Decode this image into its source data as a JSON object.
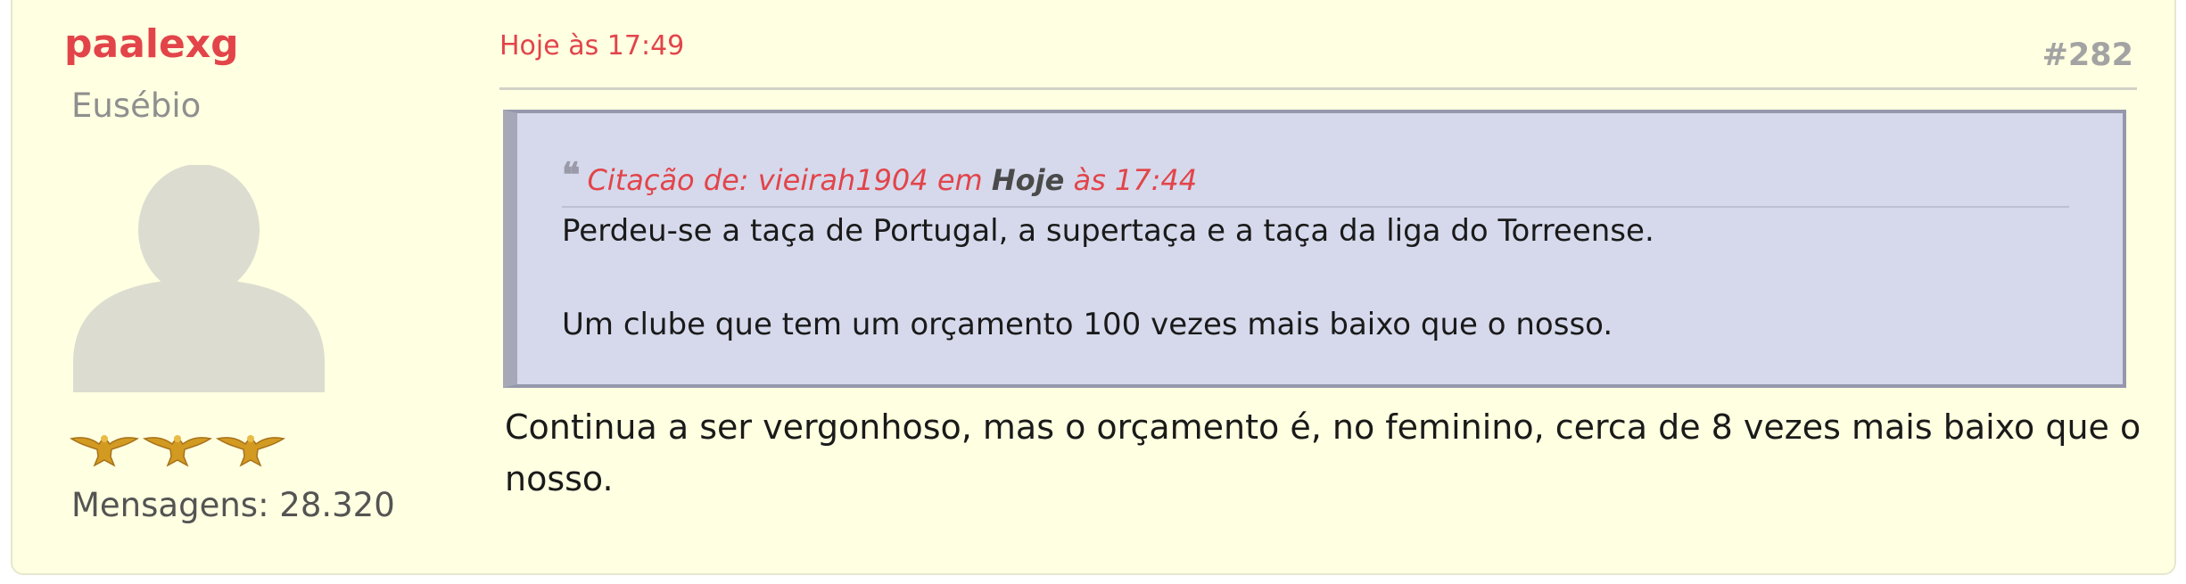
{
  "poster": {
    "username": "paalexg",
    "rank": "Eusébio",
    "avatar_icon": "default-avatar-icon",
    "stars_icon": "eagle-icon",
    "star_count": 3,
    "post_count": "Mensagens: 28.320"
  },
  "post": {
    "date": "Hoje às 17:49",
    "number": "#282",
    "quote": {
      "quote_icon": "quote-icon",
      "prefix": "Citação de: vieirah1904 em ",
      "day": "Hoje",
      "time": " às 17:44",
      "lines": [
        "Perdeu-se a taça de Portugal, a supertaça e a taça da liga do Torreense.",
        "Um clube que tem um orçamento 100 vezes mais baixo que o nosso."
      ]
    },
    "text": "Continua a ser vergonhoso, mas o orçamento é, no feminino, cerca de 8 vezes mais baixo que o nosso."
  },
  "colors": {
    "accent": "#e2444a",
    "card_background": "#ffffe1",
    "quote_background": "#d5d9eb",
    "muted": "#8f8f8f"
  }
}
